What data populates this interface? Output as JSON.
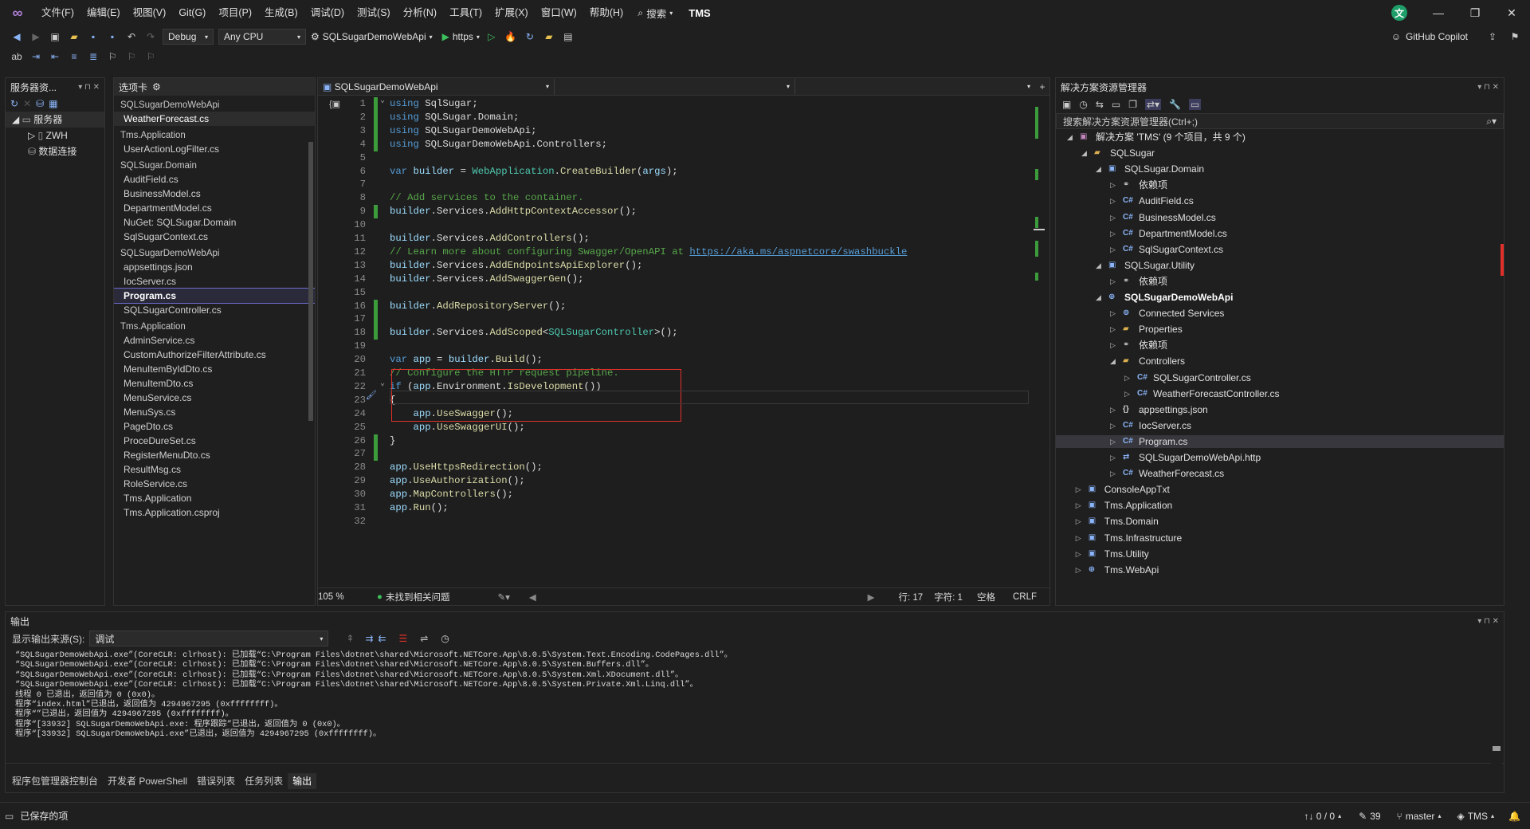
{
  "menu": {
    "items": [
      "文件(F)",
      "编辑(E)",
      "视图(V)",
      "Git(G)",
      "项目(P)",
      "生成(B)",
      "调试(D)",
      "测试(S)",
      "分析(N)",
      "工具(T)",
      "扩展(X)",
      "窗口(W)",
      "帮助(H)"
    ],
    "search": "搜索",
    "title": "TMS",
    "avatar": "文"
  },
  "toolbar": {
    "config": "Debug",
    "platform": "Any CPU",
    "startup": "SQLSugarDemoWebApi",
    "profile": "https",
    "copilot": "GitHub Copilot"
  },
  "server_explorer": {
    "title": "服务器资...",
    "root": "服务器",
    "machine": "ZWH",
    "data": "数据连接"
  },
  "tabs_panel": {
    "title": "选项卡",
    "groups": [
      {
        "name": "SQLSugarDemoWebApi",
        "files": [
          "WeatherForecast.cs"
        ]
      },
      {
        "name": "Tms.Application",
        "files": [
          "UserActionLogFilter.cs"
        ]
      },
      {
        "name": "SQLSugar.Domain",
        "files": [
          "AuditField.cs",
          "BusinessModel.cs",
          "DepartmentModel.cs",
          "NuGet: SQLSugar.Domain",
          "SqlSugarContext.cs"
        ]
      },
      {
        "name": "SQLSugarDemoWebApi",
        "files": [
          "appsettings.json",
          "IocServer.cs",
          "Program.cs",
          "SQLSugarController.cs"
        ]
      },
      {
        "name": "Tms.Application",
        "files": [
          "AdminService.cs",
          "CustomAuthorizeFilterAttribute.cs",
          "MenuItemByIdDto.cs",
          "MenuItemDto.cs",
          "MenuService.cs",
          "MenuSys.cs",
          "PageDto.cs",
          "ProceDureSet.cs",
          "RegisterMenuDto.cs",
          "ResultMsg.cs",
          "RoleService.cs",
          "Tms.Application",
          "Tms.Application.csproj"
        ]
      }
    ]
  },
  "editor": {
    "project_dropdown": "SQLSugarDemoWebApi",
    "zoom": "105 %",
    "issues": "未找到相关问题",
    "line": "行: 17",
    "col": "字符: 1",
    "ws": "空格",
    "eol": "CRLF",
    "lines": [
      [
        [
          "k",
          "using "
        ],
        [
          "",
          "SqlSugar;"
        ]
      ],
      [
        [
          "k",
          "using "
        ],
        [
          "",
          "SQLSugar.Domain;"
        ]
      ],
      [
        [
          "k",
          "using "
        ],
        [
          "",
          "SQLSugarDemoWebApi;"
        ]
      ],
      [
        [
          "k",
          "using "
        ],
        [
          "",
          "SQLSugarDemoWebApi.Controllers;"
        ]
      ],
      [],
      [
        [
          "k",
          "var "
        ],
        [
          "v",
          "builder"
        ],
        [
          "",
          " = "
        ],
        [
          "t",
          "WebApplication"
        ],
        [
          "",
          "."
        ],
        [
          "m",
          "CreateBuilder"
        ],
        [
          "",
          "("
        ],
        [
          "v",
          "args"
        ],
        [
          "",
          ");"
        ]
      ],
      [],
      [
        [
          "c",
          "// Add services to the container."
        ]
      ],
      [
        [
          "v",
          "builder"
        ],
        [
          "",
          ".Services."
        ],
        [
          "m",
          "AddHttpContextAccessor"
        ],
        [
          "",
          "();"
        ]
      ],
      [],
      [
        [
          "v",
          "builder"
        ],
        [
          "",
          ".Services."
        ],
        [
          "m",
          "AddControllers"
        ],
        [
          "",
          "();"
        ]
      ],
      [
        [
          "c",
          "// Learn more about configuring Swagger/OpenAPI at "
        ],
        [
          "u",
          "https://aka.ms/aspnetcore/swashbuckle"
        ]
      ],
      [
        [
          "v",
          "builder"
        ],
        [
          "",
          ".Services."
        ],
        [
          "m",
          "AddEndpointsApiExplorer"
        ],
        [
          "",
          "();"
        ]
      ],
      [
        [
          "v",
          "builder"
        ],
        [
          "",
          ".Services."
        ],
        [
          "m",
          "AddSwaggerGen"
        ],
        [
          "",
          "();"
        ]
      ],
      [],
      [
        [
          "v",
          "builder"
        ],
        [
          "",
          "."
        ],
        [
          "m",
          "AddRepositoryServer"
        ],
        [
          "",
          "();"
        ]
      ],
      [],
      [
        [
          "v",
          "builder"
        ],
        [
          "",
          ".Services."
        ],
        [
          "m",
          "AddScoped"
        ],
        [
          "",
          "<"
        ],
        [
          "t",
          "SQLSugarController"
        ],
        [
          "",
          ">();"
        ]
      ],
      [],
      [
        [
          "k",
          "var "
        ],
        [
          "v",
          "app"
        ],
        [
          "",
          " = "
        ],
        [
          "v",
          "builder"
        ],
        [
          "",
          "."
        ],
        [
          "m",
          "Build"
        ],
        [
          "",
          "();"
        ]
      ],
      [
        [
          "c",
          "// Configure the HTTP request pipeline."
        ]
      ],
      [
        [
          "k",
          "if "
        ],
        [
          "",
          "("
        ],
        [
          "v",
          "app"
        ],
        [
          "",
          ".Environment."
        ],
        [
          "m",
          "IsDevelopment"
        ],
        [
          "",
          "())"
        ]
      ],
      [
        [
          "",
          "{"
        ]
      ],
      [
        [
          "",
          "    "
        ],
        [
          "v",
          "app"
        ],
        [
          "",
          "."
        ],
        [
          "m",
          "UseSwagger"
        ],
        [
          "",
          "();"
        ]
      ],
      [
        [
          "",
          "    "
        ],
        [
          "v",
          "app"
        ],
        [
          "",
          "."
        ],
        [
          "m",
          "UseSwaggerUI"
        ],
        [
          "",
          "();"
        ]
      ],
      [
        [
          "",
          "}"
        ]
      ],
      [],
      [
        [
          "v",
          "app"
        ],
        [
          "",
          "."
        ],
        [
          "m",
          "UseHttpsRedirection"
        ],
        [
          "",
          "();"
        ]
      ],
      [
        [
          "v",
          "app"
        ],
        [
          "",
          "."
        ],
        [
          "m",
          "UseAuthorization"
        ],
        [
          "",
          "();"
        ]
      ],
      [
        [
          "v",
          "app"
        ],
        [
          "",
          "."
        ],
        [
          "m",
          "MapControllers"
        ],
        [
          "",
          "();"
        ]
      ],
      [
        [
          "v",
          "app"
        ],
        [
          "",
          "."
        ],
        [
          "m",
          "Run"
        ],
        [
          "",
          "();"
        ]
      ],
      []
    ]
  },
  "solution": {
    "title": "解决方案资源管理器",
    "search": "搜索解决方案资源管理器(Ctrl+;)",
    "rows": [
      {
        "d": 0,
        "t": "解决方案 'TMS' (9 个项目，共 9 个)",
        "ic": "sln"
      },
      {
        "d": 1,
        "t": "SQLSugar",
        "ic": "folder"
      },
      {
        "d": 2,
        "t": "SQLSugar.Domain",
        "ic": "proj"
      },
      {
        "d": 3,
        "t": "依赖项",
        "ic": "dep"
      },
      {
        "d": 3,
        "t": "AuditField.cs",
        "ic": "cs"
      },
      {
        "d": 3,
        "t": "BusinessModel.cs",
        "ic": "cs"
      },
      {
        "d": 3,
        "t": "DepartmentModel.cs",
        "ic": "cs"
      },
      {
        "d": 3,
        "t": "SqlSugarContext.cs",
        "ic": "cs"
      },
      {
        "d": 2,
        "t": "SQLSugar.Utility",
        "ic": "proj"
      },
      {
        "d": 3,
        "t": "依赖项",
        "ic": "dep"
      },
      {
        "d": 2,
        "t": "SQLSugarDemoWebApi",
        "ic": "web",
        "b": true
      },
      {
        "d": 3,
        "t": "Connected Services",
        "ic": "svc"
      },
      {
        "d": 3,
        "t": "Properties",
        "ic": "folder"
      },
      {
        "d": 3,
        "t": "依赖项",
        "ic": "dep"
      },
      {
        "d": 3,
        "t": "Controllers",
        "ic": "folder"
      },
      {
        "d": 4,
        "t": "SQLSugarController.cs",
        "ic": "cs"
      },
      {
        "d": 4,
        "t": "WeatherForecastController.cs",
        "ic": "cs"
      },
      {
        "d": 3,
        "t": "appsettings.json",
        "ic": "json"
      },
      {
        "d": 3,
        "t": "IocServer.cs",
        "ic": "cs"
      },
      {
        "d": 3,
        "t": "Program.cs",
        "ic": "cs",
        "sel": true
      },
      {
        "d": 3,
        "t": "SQLSugarDemoWebApi.http",
        "ic": "http"
      },
      {
        "d": 3,
        "t": "WeatherForecast.cs",
        "ic": "cs"
      },
      {
        "d": 0.6,
        "t": "ConsoleAppTxt",
        "ic": "proj"
      },
      {
        "d": 0.6,
        "t": "Tms.Application",
        "ic": "proj"
      },
      {
        "d": 0.6,
        "t": "Tms.Domain",
        "ic": "proj"
      },
      {
        "d": 0.6,
        "t": "Tms.Infrastructure",
        "ic": "proj"
      },
      {
        "d": 0.6,
        "t": "Tms.Utility",
        "ic": "proj"
      },
      {
        "d": 0.6,
        "t": "Tms.WebApi",
        "ic": "web"
      }
    ]
  },
  "output": {
    "title": "输出",
    "source_label": "显示输出来源(S):",
    "source": "调试",
    "lines": [
      "“SQLSugarDemoWebApi.exe”(CoreCLR: clrhost): 已加载“C:\\Program Files\\dotnet\\shared\\Microsoft.NETCore.App\\8.0.5\\System.Text.Encoding.CodePages.dll”。",
      "“SQLSugarDemoWebApi.exe”(CoreCLR: clrhost): 已加载“C:\\Program Files\\dotnet\\shared\\Microsoft.NETCore.App\\8.0.5\\System.Buffers.dll”。",
      "“SQLSugarDemoWebApi.exe”(CoreCLR: clrhost): 已加载“C:\\Program Files\\dotnet\\shared\\Microsoft.NETCore.App\\8.0.5\\System.Xml.XDocument.dll”。",
      "“SQLSugarDemoWebApi.exe”(CoreCLR: clrhost): 已加载“C:\\Program Files\\dotnet\\shared\\Microsoft.NETCore.App\\8.0.5\\System.Private.Xml.Linq.dll”。",
      "线程 0 已退出，返回值为 0 (0x0)。",
      "程序“index.html”已退出，返回值为 4294967295 (0xffffffff)。",
      "程序“”已退出，返回值为 4294967295 (0xffffffff)。",
      "程序“[33932] SQLSugarDemoWebApi.exe: 程序跟踪”已退出，返回值为 0 (0x0)。",
      "程序“[33932] SQLSugarDemoWebApi.exe”已退出，返回值为 4294967295 (0xffffffff)。"
    ],
    "tabs": [
      "程序包管理器控制台",
      "开发者 PowerShell",
      "错误列表",
      "任务列表",
      "输出"
    ]
  },
  "status": {
    "saved": "已保存的项",
    "sync": "↑↓ 0 / 0",
    "pen": "39",
    "branch": "master",
    "repo": "TMS"
  }
}
